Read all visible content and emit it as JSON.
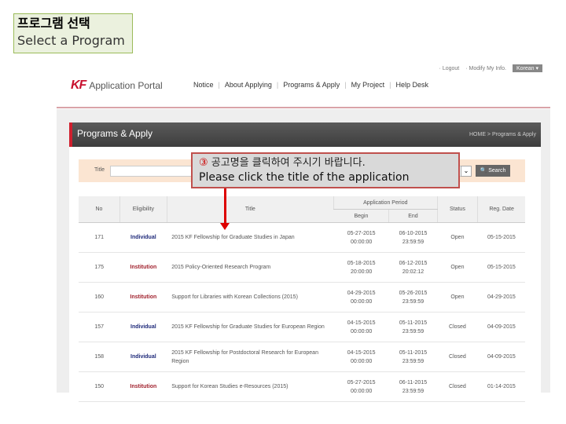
{
  "slide_label": {
    "korean": "프로그램 선택",
    "english": "Select a Program"
  },
  "util": {
    "logout": "· Logout",
    "modify": "· Modify My Info.",
    "language": "Korean ▾"
  },
  "logo": {
    "mark": "KF",
    "name": "Application Portal"
  },
  "nav": [
    "Notice",
    "About Applying",
    "Programs & Apply",
    "My Project",
    "Help Desk"
  ],
  "page": {
    "title": "Programs & Apply",
    "breadcrumb": "HOME > Programs & Apply"
  },
  "search": {
    "label": "Title",
    "value": "",
    "button": "Search",
    "dropdown_icon": "chevron-down-icon",
    "search_icon": "magnifier-icon"
  },
  "callout": {
    "number": "③",
    "korean": "공고명을 클릭하여 주시기 바랍니다.",
    "english": "Please click the title of the application"
  },
  "colors": {
    "brand": "#c8102e",
    "individual": "#1f2a7a",
    "institution": "#a1222e",
    "callout_border": "#c0504d"
  },
  "table": {
    "headers": {
      "no": "No",
      "eligibility": "Eligibility",
      "title": "Title",
      "period": "Application Period",
      "begin": "Begin",
      "end": "End",
      "status": "Status",
      "reg_date": "Reg. Date"
    },
    "rows": [
      {
        "no": "171",
        "eligibility": "Individual",
        "type": "ind",
        "title": "2015 KF Fellowship for Graduate Studies in Japan",
        "begin_date": "05-27-2015",
        "begin_time": "00:00:00",
        "end_date": "06-10-2015",
        "end_time": "23:59:59",
        "status": "Open",
        "reg_date": "05-15-2015"
      },
      {
        "no": "175",
        "eligibility": "Institution",
        "type": "ins",
        "title": "2015 Policy-Oriented Research Program",
        "begin_date": "05-18-2015",
        "begin_time": "20:00:00",
        "end_date": "06-12-2015",
        "end_time": "20:02:12",
        "status": "Open",
        "reg_date": "05-15-2015"
      },
      {
        "no": "160",
        "eligibility": "Institution",
        "type": "ins",
        "title": "Support for Libraries with Korean Collections (2015)",
        "begin_date": "04-29-2015",
        "begin_time": "00:00:00",
        "end_date": "05-26-2015",
        "end_time": "23:59:59",
        "status": "Open",
        "reg_date": "04-29-2015"
      },
      {
        "no": "157",
        "eligibility": "Individual",
        "type": "ind",
        "title": "2015 KF Fellowship for Graduate Studies for European Region",
        "begin_date": "04-15-2015",
        "begin_time": "00:00:00",
        "end_date": "05-11-2015",
        "end_time": "23:59:59",
        "status": "Closed",
        "reg_date": "04-09-2015"
      },
      {
        "no": "158",
        "eligibility": "Individual",
        "type": "ind",
        "title": "2015 KF Fellowship for Postdoctoral Research for European Region",
        "begin_date": "04-15-2015",
        "begin_time": "00:00:00",
        "end_date": "05-11-2015",
        "end_time": "23:59:59",
        "status": "Closed",
        "reg_date": "04-09-2015"
      },
      {
        "no": "150",
        "eligibility": "Institution",
        "type": "ins",
        "title": "Support for Korean Studies e-Resources (2015)",
        "begin_date": "05-27-2015",
        "begin_time": "00:00:00",
        "end_date": "06-11-2015",
        "end_time": "23:59:59",
        "status": "Closed",
        "reg_date": "01-14-2015"
      }
    ]
  }
}
